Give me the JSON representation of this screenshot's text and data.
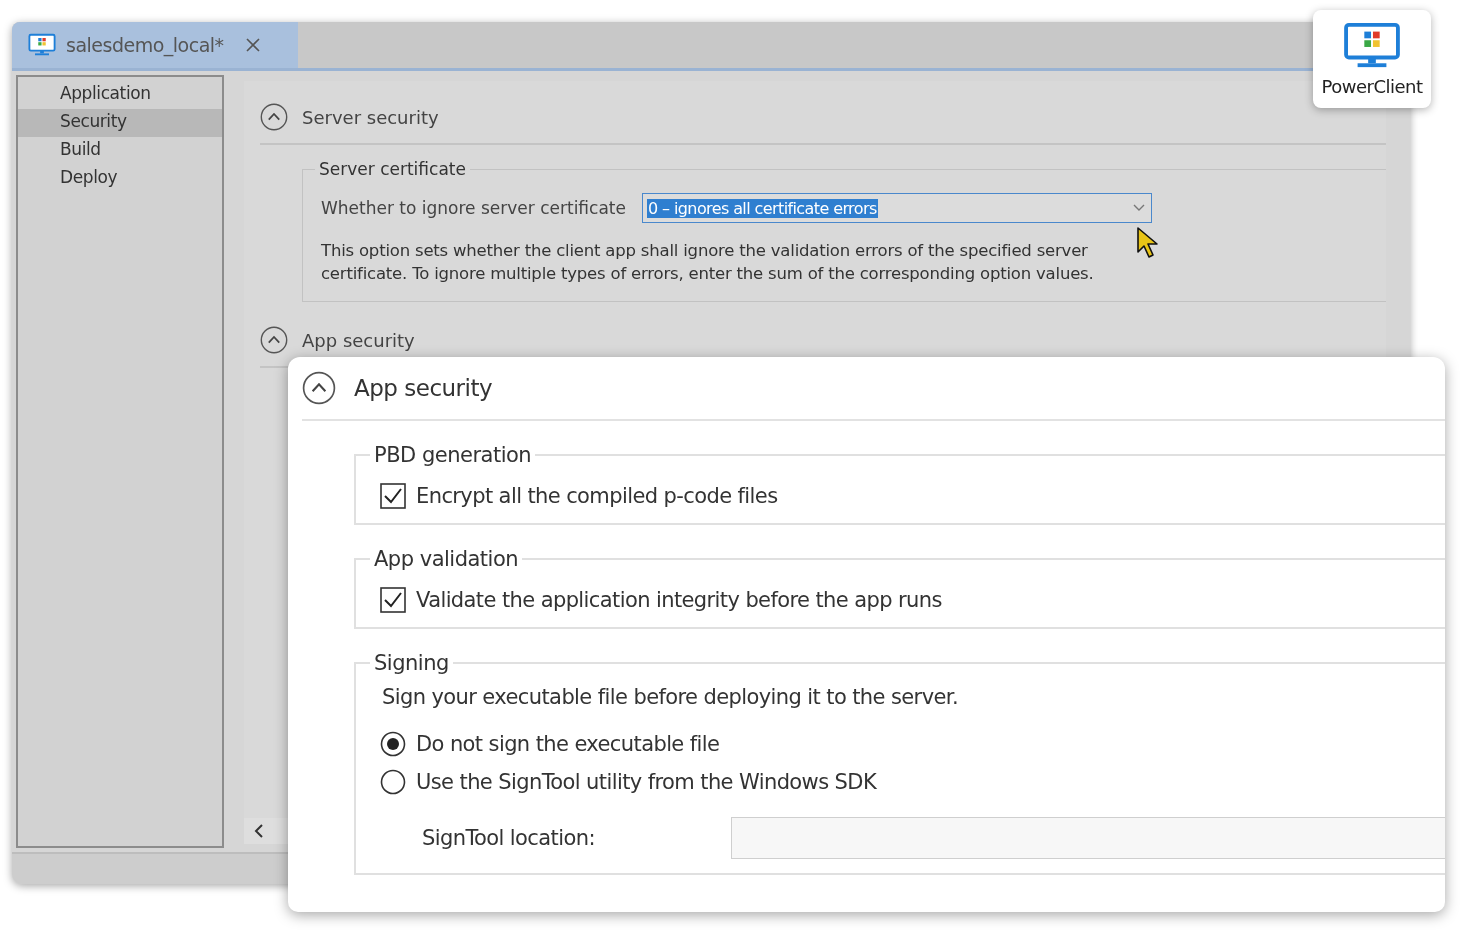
{
  "tab": {
    "title": "salesdemo_local*",
    "selected": true
  },
  "sidebar": {
    "items": [
      {
        "label": "Application",
        "selected": false
      },
      {
        "label": "Security",
        "selected": true
      },
      {
        "label": "Build",
        "selected": false
      },
      {
        "label": "Deploy",
        "selected": false
      }
    ]
  },
  "server_security": {
    "title": "Server security",
    "expanded": true,
    "group": {
      "title": "Server certificate",
      "field_label": "Whether to ignore server certificate",
      "value": "0 – ignores all certificate errors",
      "description": "This option sets whether the client app shall ignore the validation errors of the specified server certificate. To ignore multiple types of errors, enter the sum of the corresponding option values."
    }
  },
  "app_security_behind": {
    "title": "App security",
    "expanded": true
  },
  "badge": {
    "label": "PowerClient"
  },
  "app_security_panel": {
    "title": "App security",
    "expanded": true,
    "groups": [
      {
        "title": "PBD generation",
        "options": [
          {
            "kind": "checkbox",
            "label": "Encrypt all the compiled p-code files",
            "checked": true
          }
        ]
      },
      {
        "title": "App validation",
        "options": [
          {
            "kind": "checkbox",
            "label": "Validate the application integrity before the app runs",
            "checked": true
          }
        ]
      },
      {
        "title": "Signing",
        "note": "Sign your executable file before deploying it to the server.",
        "options": [
          {
            "kind": "radio",
            "label": "Do not sign the executable file",
            "selected": true
          },
          {
            "kind": "radio",
            "label": "Use the SignTool utility from the Windows SDK",
            "selected": false
          },
          {
            "kind": "field",
            "label": "SignTool location:"
          }
        ]
      }
    ]
  }
}
